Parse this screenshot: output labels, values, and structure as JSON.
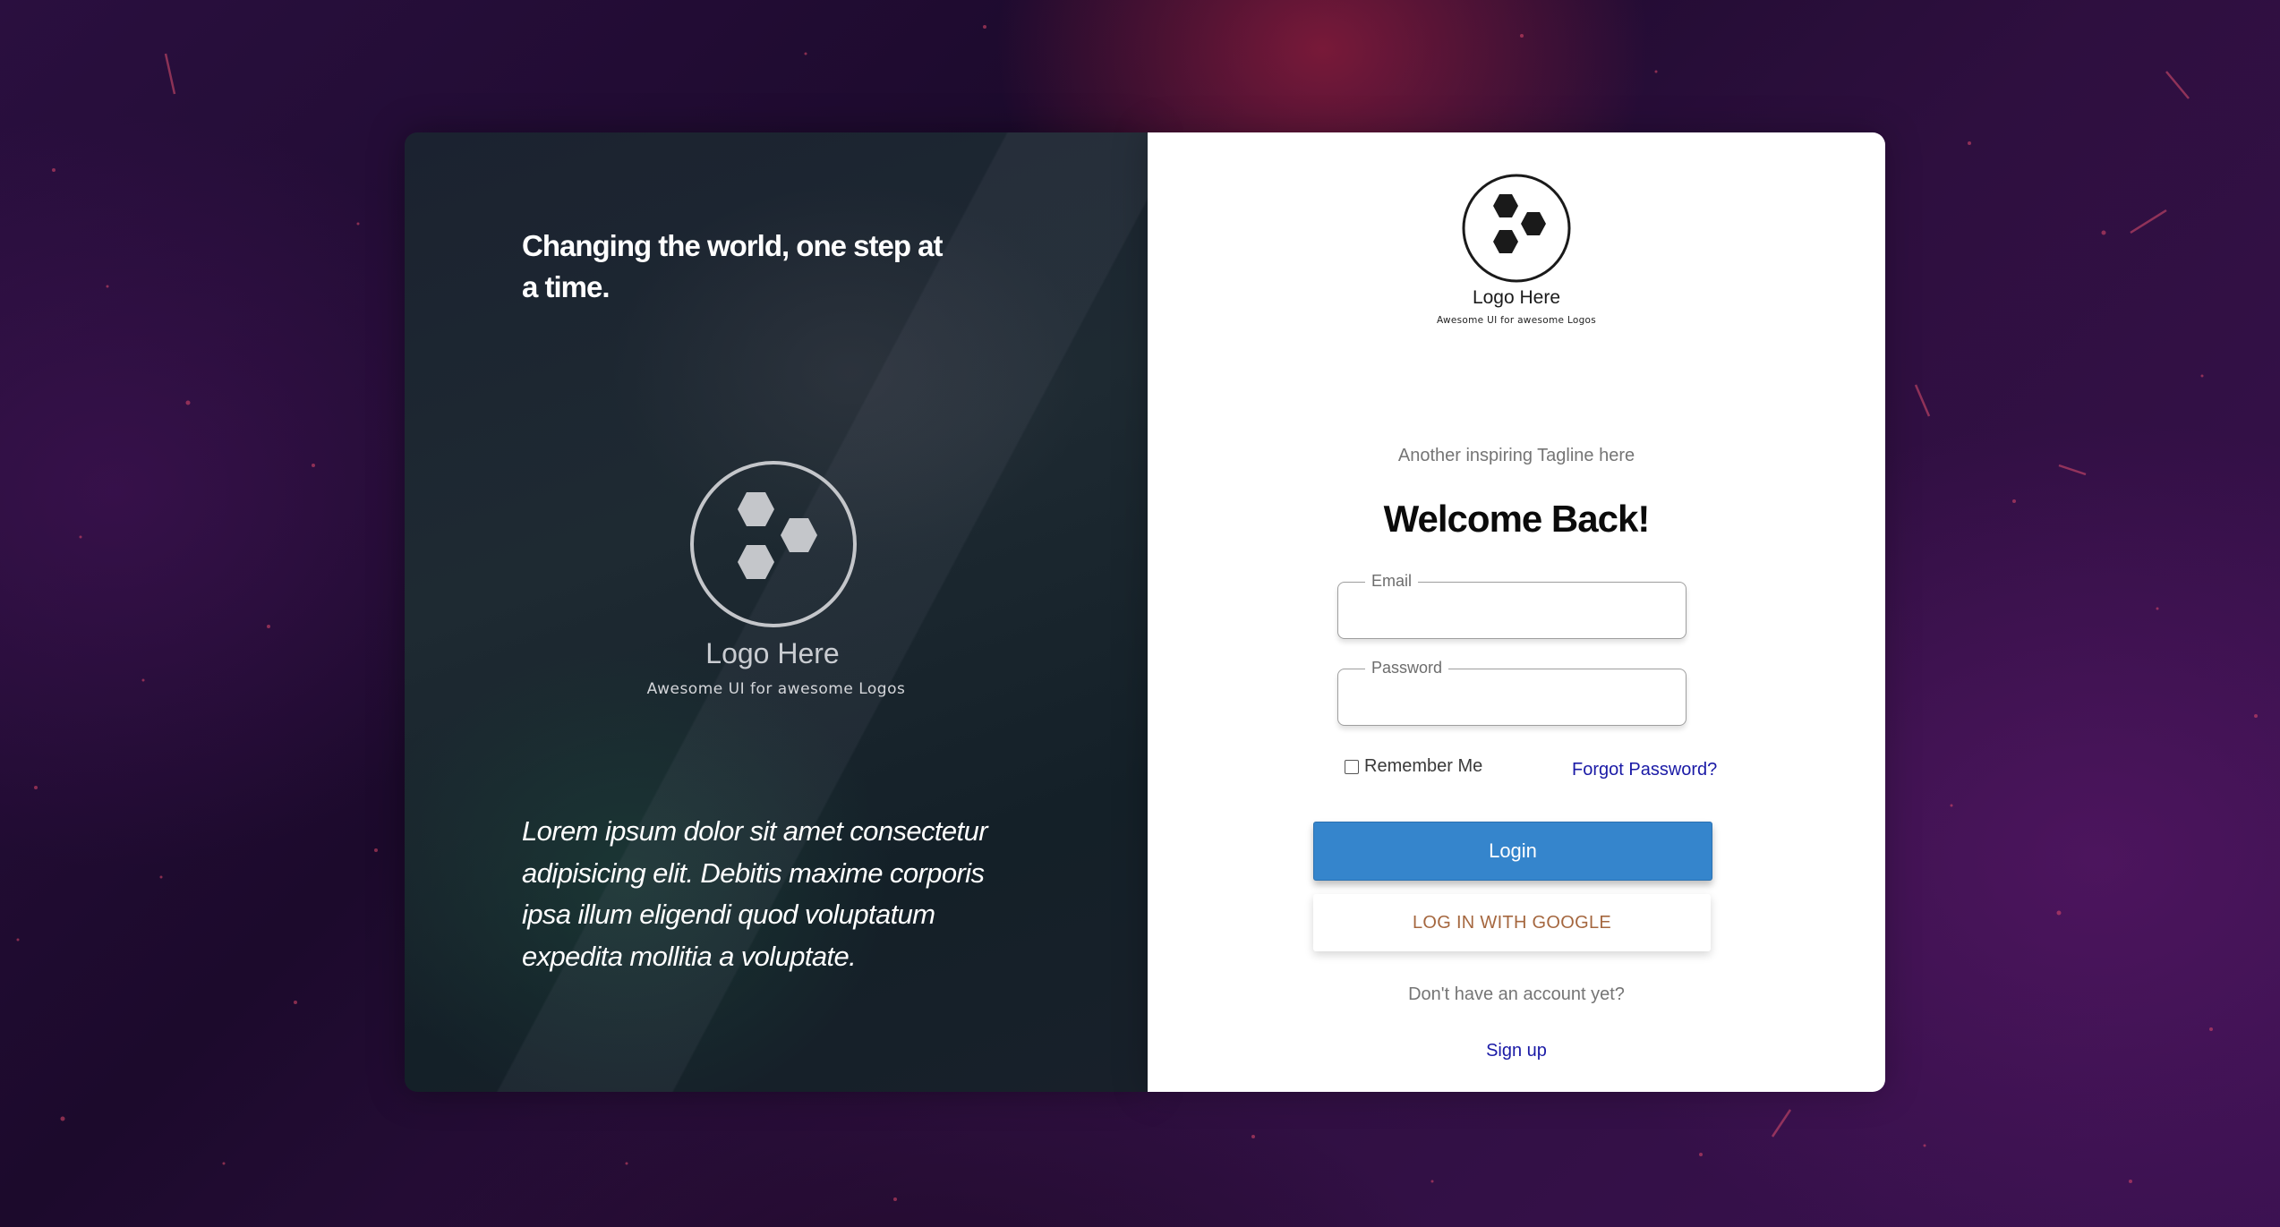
{
  "colors": {
    "primary_button": "#3585cc",
    "google_text": "#a5673f",
    "link": "#1a1aa6",
    "left_panel": "#1b2230",
    "card_background": "#ffffff"
  },
  "hero": {
    "heading": "Changing the world, one step at a time.",
    "logo_icon": "hexagon-cluster-icon",
    "logo_title": "Logo Here",
    "logo_subtitle": "Awesome UI for awesome Logos",
    "quote": "Lorem ipsum dolor sit amet consectetur adipisicing elit. Debitis maxime corporis ipsa illum eligendi quod voluptatum expedita mollitia a voluptate."
  },
  "card": {
    "logo_icon": "hexagon-cluster-icon",
    "logo_title": "Logo Here",
    "logo_subtitle": "Awesome UI for awesome Logos",
    "tagline": "Another inspiring Tagline here",
    "welcome": "Welcome Back!",
    "email": {
      "label": "Email",
      "value": "",
      "placeholder": ""
    },
    "password": {
      "label": "Password",
      "value": "",
      "placeholder": ""
    },
    "remember_me": {
      "label": "Remember Me",
      "checked": false
    },
    "forgot_password": "Forgot Password?",
    "login_button": "Login",
    "google_button": "LOG IN WITH GOOGLE",
    "no_account": "Don't have an account yet?",
    "signup": "Sign up"
  }
}
